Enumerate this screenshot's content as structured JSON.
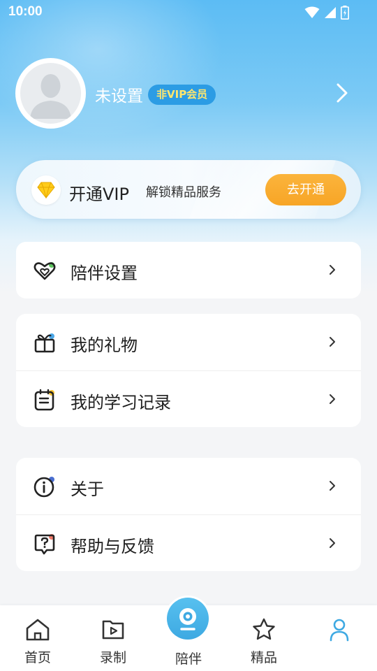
{
  "status_bar": {
    "time": "10:00"
  },
  "profile": {
    "name": "未设置",
    "badge": "非VIP会员"
  },
  "vip_card": {
    "title": "开通VIP",
    "subtitle": "解锁精品服务",
    "button": "去开通"
  },
  "menu_groups": [
    {
      "items": [
        {
          "label": "陪伴设置",
          "icon": "heart-icon"
        }
      ]
    },
    {
      "items": [
        {
          "label": "我的礼物",
          "icon": "gift-icon"
        },
        {
          "label": "我的学习记录",
          "icon": "notebook-icon"
        }
      ]
    },
    {
      "items": [
        {
          "label": "关于",
          "icon": "info-icon"
        },
        {
          "label": "帮助与反馈",
          "icon": "help-icon"
        }
      ]
    }
  ],
  "bottom_nav": {
    "home": "首页",
    "record": "录制",
    "companion": "陪伴",
    "featured": "精品",
    "active_tab": "profile"
  },
  "colors": {
    "accent_blue": "#3ea9e2",
    "vip_orange": "#f7a526",
    "badge_blue": "#2c9ce4",
    "badge_text": "#ffe66e"
  }
}
